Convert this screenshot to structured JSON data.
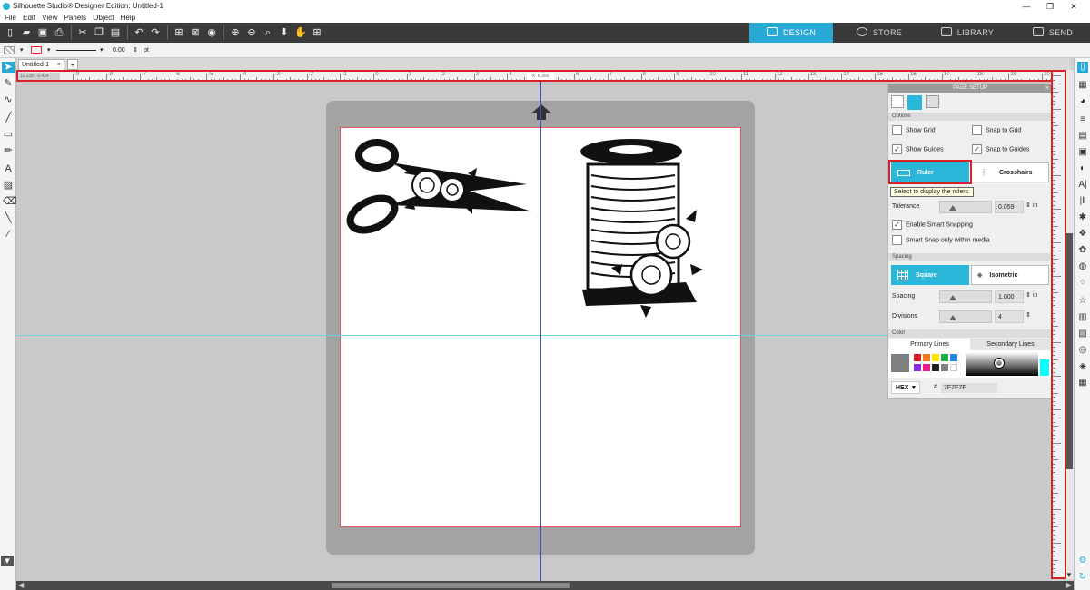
{
  "window": {
    "title": "Silhouette Studio® Designer Edition: Untitled-1",
    "min": "—",
    "restore": "❐",
    "close": "✕"
  },
  "menu": [
    "File",
    "Edit",
    "View",
    "Panels",
    "Object",
    "Help"
  ],
  "nav": {
    "design": "DESIGN",
    "store": "STORE",
    "library": "LIBRARY",
    "send": "SEND"
  },
  "options": {
    "stroke_width": "0.00",
    "unit": "pt"
  },
  "document_tab": {
    "name": "Untitled-1",
    "close": "×",
    "add": "+"
  },
  "ruler": {
    "cursor_readout": "X: 6.300",
    "corner_readout": "11.138 , 0.434",
    "h_labels": [
      "-9",
      "-8",
      "-7",
      "-6",
      "-5",
      "-4",
      "-3",
      "-2",
      "-1",
      "0",
      "1",
      "2",
      "3",
      "4",
      "5",
      "6",
      "7",
      "8",
      "9",
      "10",
      "11",
      "12",
      "13",
      "14",
      "15",
      "16",
      "17",
      "18",
      "19",
      "20",
      "21",
      "22",
      "23"
    ]
  },
  "page_setup": {
    "title": "PAGE SETUP",
    "options_header": "Options",
    "show_grid": {
      "label": "Show Grid",
      "checked": false
    },
    "snap_to_grid": {
      "label": "Snap to Grid",
      "checked": false
    },
    "show_guides": {
      "label": "Show Guides",
      "checked": true
    },
    "snap_to_guides": {
      "label": "Snap to Guides",
      "checked": true
    },
    "ruler_button": "Ruler",
    "crosshairs_button": "Crosshairs",
    "tooltip": "Select to display the rulers.",
    "tolerance_label": "Tolerance",
    "tolerance_value": "0.059",
    "tolerance_unit": "in",
    "enable_smart_snapping": {
      "label": "Enable Smart Snapping",
      "checked": true
    },
    "smart_snap_media": {
      "label": "Smart Snap only within media",
      "checked": false
    },
    "spacing_header": "Spacing",
    "square_button": "Square",
    "isometric_button": "Isometric",
    "spacing_label": "Spacing",
    "spacing_value": "1.000",
    "spacing_unit": "in",
    "divisions_label": "Divisions",
    "divisions_value": "4",
    "color_header": "Color",
    "primary_lines_tab": "Primary Lines",
    "secondary_lines_tab": "Secondary Lines",
    "hex_label": "HEX",
    "hash": "#",
    "hex_value": "7F7F7F",
    "swatches": [
      "#e02020",
      "#f07a1a",
      "#ffe600",
      "#20b04b",
      "#1e88e5",
      "#8a2be2",
      "#e91e8c",
      "#222222",
      "#7f7f7f",
      "#ffffff"
    ],
    "current_color": "#7f7f7f"
  }
}
